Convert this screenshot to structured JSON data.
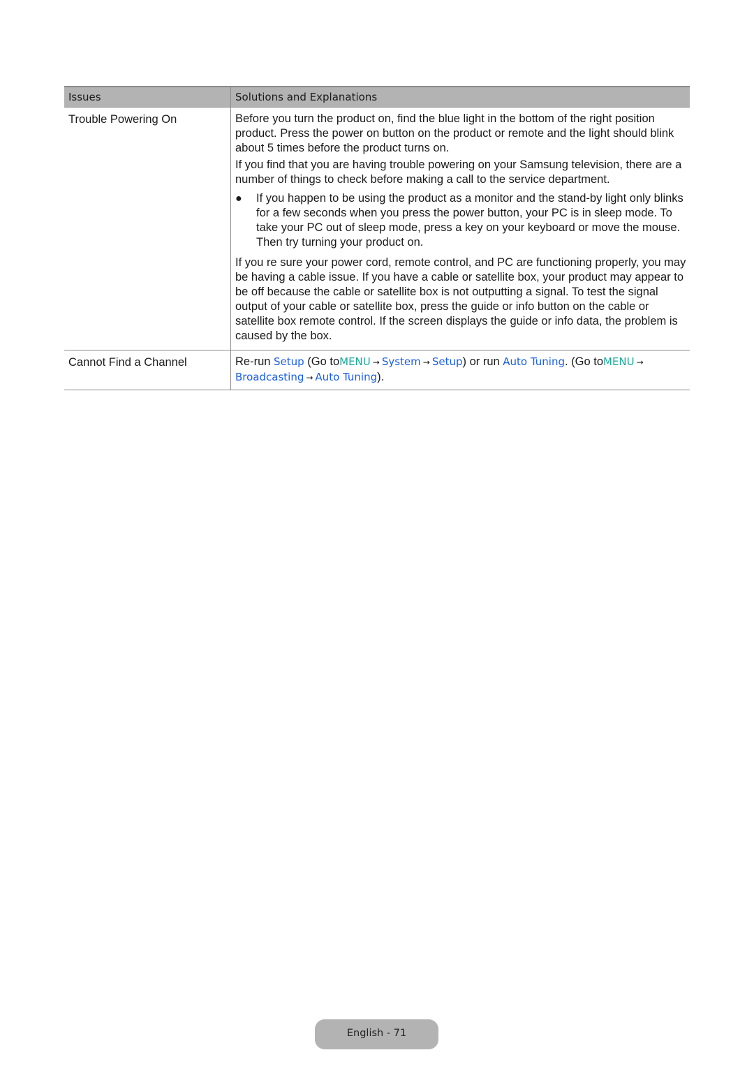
{
  "table": {
    "headers": [
      "Issues",
      "Solutions and Explanations"
    ],
    "rows": [
      {
        "issue": "Trouble Powering On",
        "paragraphs": [
          "Before you turn the product on, find the blue light in the bottom of the right position product. Press the power on button on the product or remote and the light should blink about 5 times before the product turns on.",
          "If you find that you are having trouble powering on your Samsung television, there are a number of things to check before making a call to the service department."
        ],
        "bullet": "If you happen to be using the product as a monitor and the stand-by light only blinks for a few seconds when you press the power button, your PC is in sleep mode. To take your PC out of sleep mode, press a key on your keyboard or move the mouse. Then try turning your product on.",
        "closing": "If you re sure your power cord, remote control, and PC are functioning properly, you may be having a cable issue. If you have a cable or satellite box, your product may appear to be off because the cable or satellite box is not outputting a signal. To test the signal output of your cable or satellite box, press the guide or info button on the cable or satellite box remote control. If the screen displays the guide or info data, the problem is caused by the box."
      },
      {
        "issue": "Cannot Find a Channel",
        "solution": {
          "t1": "Re-run ",
          "setup": "Setup",
          "t2": " (Go to",
          "menu": "MENU",
          "arrow": "→",
          "system": "System",
          "setup2": "Setup",
          "t3": ") or run ",
          "auto_tuning": "Auto Tuning",
          "t4": ". (Go to",
          "menu2": "MENU",
          "broadcasting": "Broadcasting",
          "auto_tuning2": "Auto Tuning",
          "t5": ")."
        }
      }
    ]
  },
  "footer": {
    "page_label": "English - 71"
  },
  "colors": {
    "link_blue": "#1a5fd8",
    "menu_teal": "#1aa89a",
    "header_gray": "#b3b3b3"
  }
}
